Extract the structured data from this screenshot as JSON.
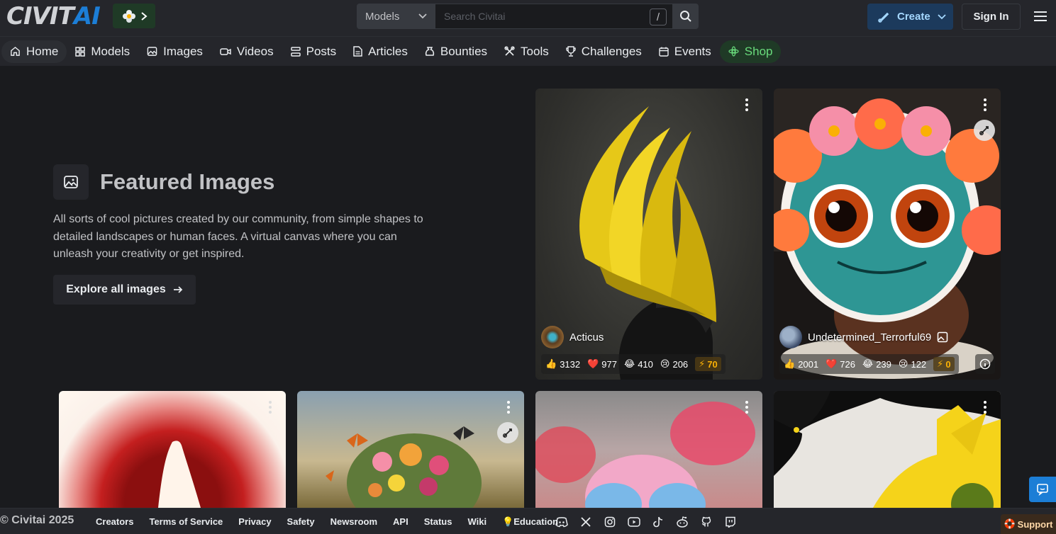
{
  "header": {
    "logo_civ": "CIVIT",
    "logo_ai": "AI",
    "search_select": "Models",
    "search_placeholder": "Search Civitai",
    "search_shortcut": "/",
    "create_label": "Create",
    "signin_label": "Sign In"
  },
  "nav": {
    "items": [
      {
        "label": "Home",
        "icon": "home-icon"
      },
      {
        "label": "Models",
        "icon": "grid-icon"
      },
      {
        "label": "Images",
        "icon": "photo-icon"
      },
      {
        "label": "Videos",
        "icon": "video-icon"
      },
      {
        "label": "Posts",
        "icon": "posts-icon"
      },
      {
        "label": "Articles",
        "icon": "article-icon"
      },
      {
        "label": "Bounties",
        "icon": "moneybag-icon"
      },
      {
        "label": "Tools",
        "icon": "tools-icon"
      },
      {
        "label": "Challenges",
        "icon": "trophy-icon"
      },
      {
        "label": "Events",
        "icon": "calendar-icon"
      },
      {
        "label": "Shop",
        "icon": "shop-icon"
      }
    ]
  },
  "featured": {
    "title": "Featured Images",
    "description": "All sorts of cool pictures created by our community, from simple shapes to detailed landscapes or human faces. A virtual canvas where you can unleash your creativity or get inspired.",
    "explore_label": "Explore all images"
  },
  "cards": [
    {
      "author": "Acticus",
      "likes": "3132",
      "hearts": "977",
      "laughs": "410",
      "cries": "206",
      "buzz": "70"
    },
    {
      "author": "Undetermined_Terrorful69",
      "likes": "2001",
      "hearts": "726",
      "laughs": "239",
      "cries": "122",
      "buzz": "0"
    }
  ],
  "footer": {
    "copyright": "© Civitai 2025",
    "links": [
      "Creators",
      "Terms of Service",
      "Privacy",
      "Safety",
      "Newsroom",
      "API",
      "Status",
      "Wiki",
      "💡Education"
    ],
    "support_label": "Support"
  },
  "colors": {
    "accent": "#1c7ed6",
    "background": "#1a1b1e",
    "surface": "#25262b",
    "shop_green": "#69db7c",
    "buzz": "#fab005"
  }
}
